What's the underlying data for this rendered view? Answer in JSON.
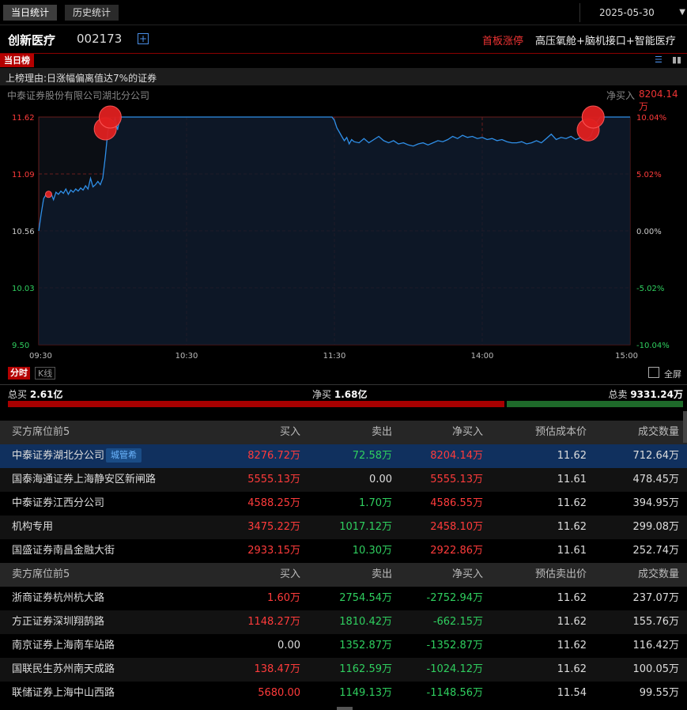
{
  "tabs": [
    {
      "label": "当日统计",
      "active": true
    },
    {
      "label": "历史统计",
      "active": false
    }
  ],
  "date": "2025-05-30",
  "stock": {
    "name": "创新医疗",
    "code": "002173",
    "status": "首板涨停",
    "concepts": "高压氧舱+脑机接口+智能医疗"
  },
  "board_tag": "当日榜",
  "reason": "上榜理由:日涨幅偏离值达7%的证券",
  "seat": {
    "name": "中泰证券股份有限公司湖北分公司",
    "net_buy_label": "净买入",
    "net_buy_value": "8204.14万"
  },
  "chart_tabs": {
    "active": "分时",
    "inactive": "K线",
    "fullscreen": "全屏"
  },
  "chart_data": {
    "type": "line",
    "x_ticks": [
      "09:30",
      "10:30",
      "11:30",
      "14:00",
      "15:00"
    ],
    "y_left_ticks": [
      "11.62",
      "11.09",
      "10.56",
      "10.03",
      "9.50"
    ],
    "y_right_ticks": [
      "10.04%",
      "5.02%",
      "0.00%",
      "-5.02%",
      "-10.04%"
    ],
    "ylim": [
      9.5,
      11.62
    ],
    "prev_close": 10.56,
    "minutes_total": 240,
    "series": [
      {
        "values": [
          [
            0,
            10.56
          ],
          [
            1,
            10.72
          ],
          [
            2,
            10.86
          ],
          [
            3,
            10.9
          ],
          [
            4,
            10.88
          ],
          [
            5,
            10.91
          ],
          [
            6,
            10.85
          ],
          [
            7,
            10.92
          ],
          [
            8,
            10.9
          ],
          [
            9,
            10.93
          ],
          [
            10,
            10.91
          ],
          [
            11,
            10.95
          ],
          [
            12,
            10.9
          ],
          [
            13,
            10.94
          ],
          [
            14,
            10.92
          ],
          [
            15,
            10.95
          ],
          [
            16,
            10.93
          ],
          [
            17,
            10.96
          ],
          [
            18,
            10.94
          ],
          [
            19,
            10.98
          ],
          [
            20,
            10.95
          ],
          [
            21,
            11.05
          ],
          [
            22,
            10.97
          ],
          [
            23,
            10.99
          ],
          [
            24,
            11.02
          ],
          [
            25,
            10.99
          ],
          [
            26,
            11.05
          ],
          [
            27,
            11.25
          ],
          [
            28,
            11.48
          ],
          [
            29,
            11.6
          ],
          [
            30,
            11.54
          ],
          [
            31,
            11.61
          ],
          [
            32,
            11.5
          ],
          [
            33,
            11.62
          ],
          [
            60,
            11.62
          ],
          [
            90,
            11.62
          ],
          [
            119,
            11.62
          ],
          [
            120,
            11.59
          ],
          [
            121,
            11.52
          ],
          [
            122,
            11.48
          ],
          [
            123,
            11.44
          ],
          [
            124,
            11.4
          ],
          [
            125,
            11.43
          ],
          [
            126,
            11.37
          ],
          [
            127,
            11.41
          ],
          [
            128,
            11.39
          ],
          [
            130,
            11.38
          ],
          [
            132,
            11.42
          ],
          [
            134,
            11.38
          ],
          [
            136,
            11.41
          ],
          [
            138,
            11.44
          ],
          [
            140,
            11.4
          ],
          [
            142,
            11.38
          ],
          [
            144,
            11.4
          ],
          [
            146,
            11.37
          ],
          [
            148,
            11.38
          ],
          [
            150,
            11.36
          ],
          [
            152,
            11.35
          ],
          [
            154,
            11.37
          ],
          [
            156,
            11.38
          ],
          [
            158,
            11.36
          ],
          [
            160,
            11.38
          ],
          [
            162,
            11.4
          ],
          [
            164,
            11.39
          ],
          [
            166,
            11.41
          ],
          [
            168,
            11.44
          ],
          [
            170,
            11.42
          ],
          [
            172,
            11.45
          ],
          [
            174,
            11.43
          ],
          [
            176,
            11.44
          ],
          [
            178,
            11.42
          ],
          [
            180,
            11.43
          ],
          [
            182,
            11.41
          ],
          [
            184,
            11.42
          ],
          [
            186,
            11.4
          ],
          [
            188,
            11.41
          ],
          [
            190,
            11.39
          ],
          [
            192,
            11.38
          ],
          [
            194,
            11.38
          ],
          [
            196,
            11.39
          ],
          [
            198,
            11.37
          ],
          [
            200,
            11.38
          ],
          [
            202,
            11.4
          ],
          [
            204,
            11.38
          ],
          [
            206,
            11.42
          ],
          [
            208,
            11.46
          ],
          [
            210,
            11.41
          ],
          [
            212,
            11.43
          ],
          [
            214,
            11.42
          ],
          [
            216,
            11.44
          ],
          [
            218,
            11.41
          ],
          [
            220,
            11.43
          ],
          [
            222,
            11.41
          ],
          [
            224,
            11.44
          ],
          [
            226,
            11.56
          ],
          [
            228,
            11.62
          ],
          [
            240,
            11.62
          ]
        ]
      }
    ],
    "markers": [
      {
        "minute": 4,
        "price": 10.9,
        "size": "small"
      },
      {
        "minute": 27,
        "price": 11.51,
        "size": "large"
      },
      {
        "minute": 29,
        "price": 11.62,
        "size": "large"
      },
      {
        "minute": 223,
        "price": 11.5,
        "size": "large"
      },
      {
        "minute": 225,
        "price": 11.62,
        "size": "large"
      }
    ],
    "grid": true
  },
  "colors": {
    "line": "#2f8fe8",
    "up": "#ff3b3b",
    "down": "#2fcf5f",
    "grid": "#6a1e1e",
    "marker": "#e02020"
  },
  "totals": {
    "buy_label": "总买",
    "buy_value": "2.61亿",
    "net_label": "净买",
    "net_value": "1.68亿",
    "sell_label": "总卖",
    "sell_value": "9331.24万",
    "buy_ratio": 0.737
  },
  "buy_table": {
    "headers": [
      "买方席位前5",
      "买入",
      "卖出",
      "净买入",
      "预估成本价",
      "成交数量"
    ],
    "rows": [
      {
        "name": "中泰证券湖北分公司",
        "badge": "城管希",
        "buy": "8276.72万",
        "sell": "72.58万",
        "net": "8204.14万",
        "price": "11.62",
        "qty": "712.64万",
        "buy_c": "red",
        "sell_c": "green",
        "net_c": "red",
        "selected": true
      },
      {
        "name": "国泰海通证券上海静安区新闸路",
        "badge": "",
        "buy": "5555.13万",
        "sell": "0.00",
        "net": "5555.13万",
        "price": "11.61",
        "qty": "478.45万",
        "buy_c": "red",
        "sell_c": "white",
        "net_c": "red",
        "selected": false
      },
      {
        "name": "中泰证券江西分公司",
        "badge": "",
        "buy": "4588.25万",
        "sell": "1.70万",
        "net": "4586.55万",
        "price": "11.62",
        "qty": "394.95万",
        "buy_c": "red",
        "sell_c": "green",
        "net_c": "red",
        "selected": false
      },
      {
        "name": "机构专用",
        "badge": "",
        "buy": "3475.22万",
        "sell": "1017.12万",
        "net": "2458.10万",
        "price": "11.62",
        "qty": "299.08万",
        "buy_c": "red",
        "sell_c": "green",
        "net_c": "red",
        "selected": false
      },
      {
        "name": "国盛证券南昌金融大街",
        "badge": "",
        "buy": "2933.15万",
        "sell": "10.30万",
        "net": "2922.86万",
        "price": "11.61",
        "qty": "252.74万",
        "buy_c": "red",
        "sell_c": "green",
        "net_c": "red",
        "selected": false
      }
    ]
  },
  "sell_table": {
    "headers": [
      "卖方席位前5",
      "买入",
      "卖出",
      "净买入",
      "预估卖出价",
      "成交数量"
    ],
    "rows": [
      {
        "name": "浙商证券杭州杭大路",
        "badge": "",
        "buy": "1.60万",
        "sell": "2754.54万",
        "net": "-2752.94万",
        "price": "11.62",
        "qty": "237.07万",
        "buy_c": "red",
        "sell_c": "green",
        "net_c": "green",
        "selected": false
      },
      {
        "name": "方正证券深圳翔鹄路",
        "badge": "",
        "buy": "1148.27万",
        "sell": "1810.42万",
        "net": "-662.15万",
        "price": "11.62",
        "qty": "155.76万",
        "buy_c": "red",
        "sell_c": "green",
        "net_c": "green",
        "selected": false
      },
      {
        "name": "南京证券上海南车站路",
        "badge": "",
        "buy": "0.00",
        "sell": "1352.87万",
        "net": "-1352.87万",
        "price": "11.62",
        "qty": "116.42万",
        "buy_c": "white",
        "sell_c": "green",
        "net_c": "green",
        "selected": false
      },
      {
        "name": "国联民生苏州南天成路",
        "badge": "",
        "buy": "138.47万",
        "sell": "1162.59万",
        "net": "-1024.12万",
        "price": "11.62",
        "qty": "100.05万",
        "buy_c": "red",
        "sell_c": "green",
        "net_c": "green",
        "selected": false
      },
      {
        "name": "联储证券上海中山西路",
        "badge": "",
        "buy": "5680.00",
        "sell": "1149.13万",
        "net": "-1148.56万",
        "price": "11.54",
        "qty": "99.55万",
        "buy_c": "red",
        "sell_c": "green",
        "net_c": "green",
        "selected": false
      }
    ]
  }
}
